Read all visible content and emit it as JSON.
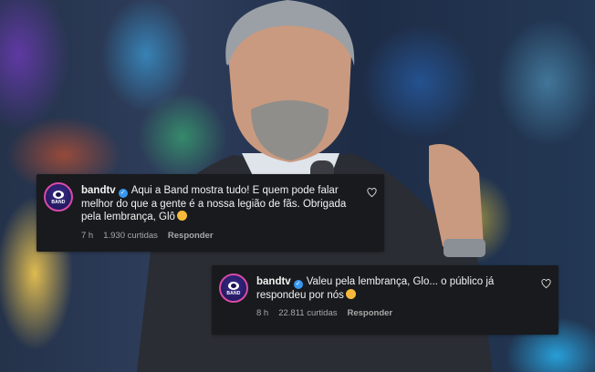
{
  "comments": [
    {
      "username": "bandtv",
      "avatar_label": "BAND",
      "text": "Aqui a Band mostra tudo! E quem pode falar melhor do que a gente é a nossa legião de fãs. Obrigada pela lembrança, Glô",
      "time": "7 h",
      "likes": "1.930 curtidas",
      "reply_label": "Responder"
    },
    {
      "username": "bandtv",
      "avatar_label": "BAND",
      "text": "Valeu pela lembrança, Glo... o público já respondeu por nós",
      "time": "8 h",
      "likes": "22.811 curtidas",
      "reply_label": "Responder"
    }
  ],
  "colors": {
    "comment_bg": "#181a1d",
    "verified": "#3897f0",
    "meta_text": "#a8a8a8",
    "avatar_ring": "#d94aa8"
  },
  "icons": [
    "verified-badge-icon",
    "heart-icon",
    "smiling-emoji-icon",
    "band-logo-icon"
  ]
}
